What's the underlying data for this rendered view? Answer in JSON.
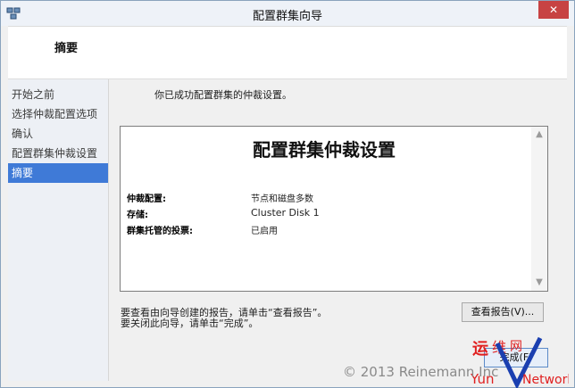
{
  "window": {
    "title": "配置群集向导",
    "close_glyph": "✕"
  },
  "header": {
    "title": "摘要"
  },
  "sidebar": {
    "items": [
      {
        "label": "开始之前",
        "active": false
      },
      {
        "label": "选择仲裁配置选项",
        "active": false
      },
      {
        "label": "确认",
        "active": false
      },
      {
        "label": "配置群集仲裁设置",
        "active": false
      },
      {
        "label": "摘要",
        "active": true
      }
    ]
  },
  "main": {
    "success_text": "你已成功配置群集的仲裁设置。",
    "report": {
      "title": "配置群集仲裁设置",
      "rows": [
        {
          "key": "仲裁配置:",
          "value": "节点和磁盘多数"
        },
        {
          "key": "存储:",
          "value": "Cluster Disk 1"
        },
        {
          "key": "群集托管的投票:",
          "value": "已启用"
        }
      ]
    },
    "note1": "要查看由向导创建的报告，请单击“查看报告”。",
    "note2": "要关闭此向导，请单击“完成”。",
    "view_report_label": "查看报告(V)...",
    "finish_label": "完成(F)"
  },
  "overlay": {
    "copyright": "© 2013 Reinemann Inc",
    "watermark": "运维网 YunVNetwork"
  },
  "colors": {
    "accent": "#3f7ad7",
    "close": "#c74343",
    "watermark_red": "#e02020"
  }
}
